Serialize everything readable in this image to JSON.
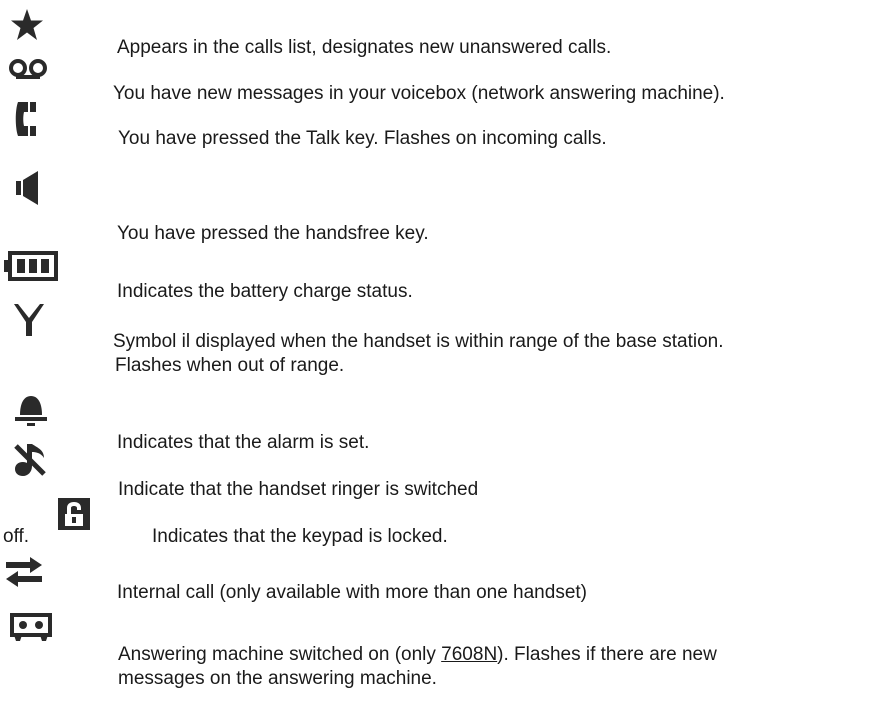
{
  "legend": [
    {
      "icon": "star-icon",
      "text": "Appears in the calls list, designates new unanswered calls."
    },
    {
      "icon": "voicemail-icon",
      "text": "You have new messages in your voicebox (network answering machine)."
    },
    {
      "icon": "handset-icon",
      "text": "You have pressed the Talk key. Flashes on incoming calls."
    },
    {
      "icon": "speaker-icon",
      "text": "You have pressed the handsfree key."
    },
    {
      "icon": "battery-icon",
      "text": "Indicates the battery charge status."
    },
    {
      "icon": "antenna-icon",
      "text": "Symbol il displayed when the handset is within range of the base station.",
      "text2": "Flashes when out of range."
    },
    {
      "icon": "bell-icon",
      "text": "Indicates that the alarm is set."
    },
    {
      "icon": "ringer-off-icon",
      "text": "Indicate that the handset ringer is switched"
    },
    {
      "icon": "lock-icon",
      "prefix": "off.",
      "text": "Indicates that the keypad is locked."
    },
    {
      "icon": "internal-call-icon",
      "text": "Internal call (only available with more than one handset)"
    },
    {
      "icon": "answering-machine-icon",
      "text_a": "Answering machine switched on (only ",
      "link": "7608N",
      "text_b": "). Flashes if there are new",
      "text2": "messages on the answering machine."
    }
  ]
}
